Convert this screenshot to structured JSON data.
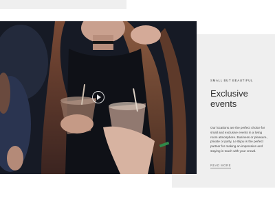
{
  "section": {
    "eyebrow": "SMALL BUT BEAUTIFUL",
    "heading_line1": "Exclusive",
    "heading_line2": "events",
    "body": "Our locations are the perfect choice for small and exclusive events in a living room atmosphere. Business or pleasure, private or party, Le Bijou is the perfect partner for making an impression and staying in touch with your crowd.",
    "read_more": "READ MORE"
  },
  "media": {
    "play_icon": "play-icon"
  },
  "colors": {
    "panel_bg": "#efefef",
    "text": "#333333",
    "photo_dark": "#1d2230"
  }
}
